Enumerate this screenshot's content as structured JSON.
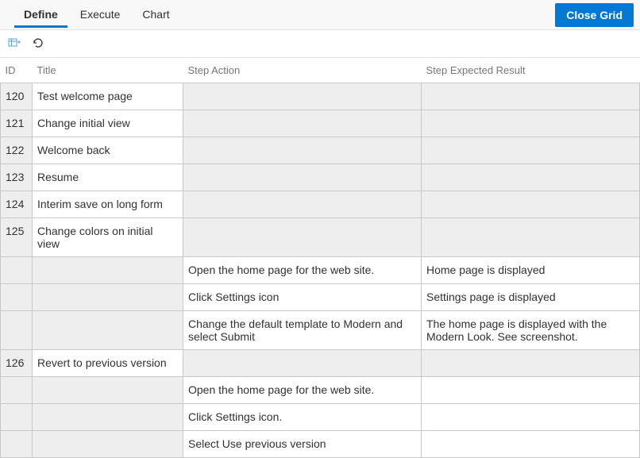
{
  "tabs": {
    "define": "Define",
    "execute": "Execute",
    "chart": "Chart"
  },
  "active_tab": "define",
  "close_button": "Close Grid",
  "columns": {
    "id": "ID",
    "title": "Title",
    "action": "Step Action",
    "result": "Step Expected Result"
  },
  "rows": [
    {
      "id": "120",
      "title": "Test welcome page",
      "action": "",
      "result": ""
    },
    {
      "id": "121",
      "title": "Change initial view",
      "action": "",
      "result": ""
    },
    {
      "id": "122",
      "title": "Welcome back",
      "action": "",
      "result": ""
    },
    {
      "id": "123",
      "title": "Resume",
      "action": "",
      "result": ""
    },
    {
      "id": "124",
      "title": "Interim save on long form",
      "action": "",
      "result": ""
    },
    {
      "id": "125",
      "title": "Change colors on initial view",
      "action": "",
      "result": ""
    },
    {
      "id": "",
      "title": "",
      "action": "Open the home page for the web site.",
      "result": "Home page is displayed"
    },
    {
      "id": "",
      "title": "",
      "action": "Click Settings icon",
      "result": "Settings page is displayed"
    },
    {
      "id": "",
      "title": "",
      "action": "Change the default template to Modern and select Submit",
      "result": "The home page is displayed with the Modern Look. See screenshot."
    },
    {
      "id": "126",
      "title": "Revert to previous version",
      "action": "",
      "result": ""
    },
    {
      "id": "",
      "title": "",
      "action": "Open the home page for the web site.",
      "result": ""
    },
    {
      "id": "",
      "title": "",
      "action": "Click Settings icon.",
      "result": ""
    },
    {
      "id": "",
      "title": "",
      "action": "Select Use previous version",
      "result": ""
    }
  ]
}
